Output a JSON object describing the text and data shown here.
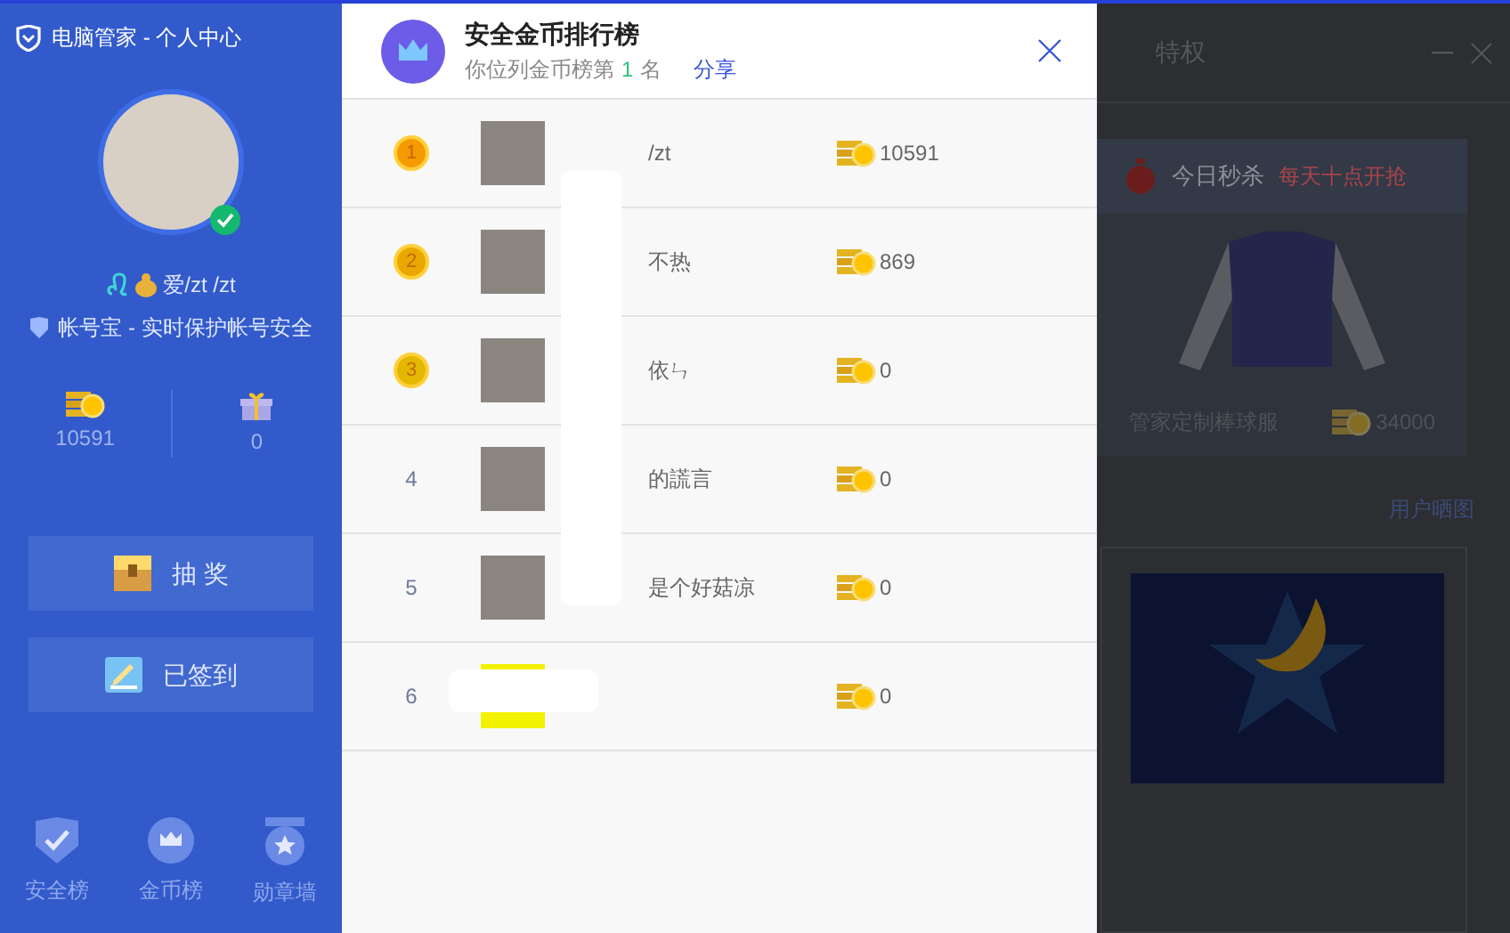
{
  "window": {
    "title": "电脑管家 - 个人中心"
  },
  "profile": {
    "verified": true,
    "name": "爱/zt /zt",
    "security": "帐号宝 - 实时保护帐号安全"
  },
  "stats": [
    {
      "kind": "coins",
      "value": "10591"
    },
    {
      "kind": "gifts",
      "value": "0"
    }
  ],
  "actions": [
    {
      "kind": "lottery",
      "label": "抽 奖"
    },
    {
      "kind": "signin",
      "label": "已签到"
    }
  ],
  "bottom_nav": [
    {
      "kind": "security",
      "label": "安全榜"
    },
    {
      "kind": "coins",
      "label": "金币榜"
    },
    {
      "kind": "medals",
      "label": "勋章墙"
    }
  ],
  "ranking": {
    "title": "安全金币排行榜",
    "rank_prefix": "你位列金币榜第",
    "rank": "1",
    "rank_suffix": "名",
    "share": "分享",
    "rows": [
      {
        "rank": "1",
        "kind": "medal",
        "color": "#f59a00",
        "name": "/zt",
        "coins": "10591"
      },
      {
        "rank": "2",
        "kind": "medal",
        "color": "#e8a800",
        "name": "不热",
        "coins": "869"
      },
      {
        "rank": "3",
        "kind": "medal",
        "color": "#e4b800",
        "name": "依ㄣ",
        "coins": "0"
      },
      {
        "rank": "4",
        "kind": "plain",
        "name": "的謊言",
        "coins": "0"
      },
      {
        "rank": "5",
        "kind": "plain",
        "name": "是个好菇凉",
        "coins": "0"
      },
      {
        "rank": "6",
        "kind": "plain",
        "coins": "0"
      }
    ]
  },
  "background_window": {
    "tab": "特权",
    "flash_sale": "今日秒杀",
    "flash_sale_note": "每天十点开抢",
    "product": "管家定制棒球服",
    "price": "34000",
    "gallery": "用户晒图"
  }
}
